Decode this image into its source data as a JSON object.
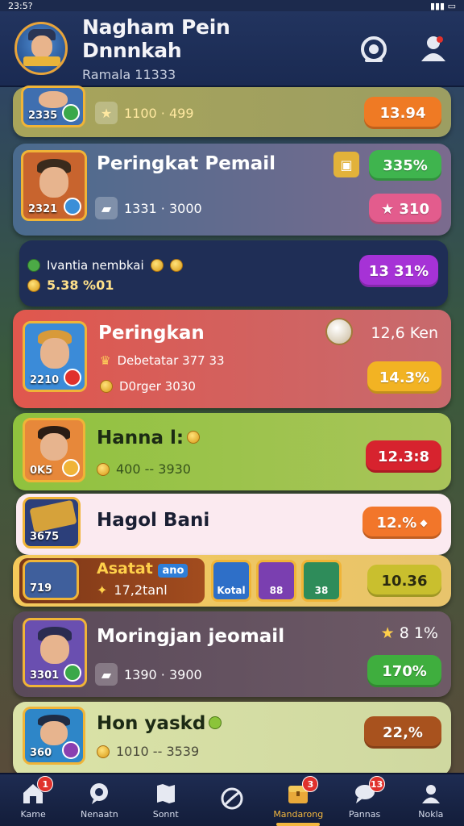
{
  "status": {
    "time": "23:5?"
  },
  "header": {
    "title": "Nagham Pein Dnnnkah",
    "subtitle": "Ramala 11333"
  },
  "cards": [
    {
      "stat": "1100 · 499",
      "pill": "13.94"
    },
    {
      "title": "Peringkat Pemail",
      "avatar_num": "2321",
      "stat": "1331 · 3000",
      "pill_top": "335%",
      "pill": "310"
    },
    {
      "text": "Ivantia nembkai",
      "amount": "5.38 %01",
      "pill": "13 31%"
    },
    {
      "title": "Peringkan",
      "avatar_num": "2210",
      "stat1": "Debetatar 377 33",
      "stat2": "D0rger 3030",
      "right_text": "12,6 Ken",
      "pill": "14.3%"
    },
    {
      "title": "Hanna l:",
      "avatar_num": "0K5",
      "stat": "400 -- 3930",
      "pill": "12.3:8"
    },
    {
      "title": "Hagol Bani",
      "avatar_num": "3675",
      "pill": "12.%"
    },
    {
      "title": "Asatat",
      "title_tag": "ano",
      "avatar_num": "719",
      "stat": "17,2tanl",
      "tiles": [
        "Kotal",
        "88",
        "38"
      ],
      "pill": "10.36"
    },
    {
      "title": "Moringjan jeomail",
      "avatar_num": "3301",
      "stat": "1390 · 3900",
      "right_text": "8 1%",
      "pill": "170%"
    },
    {
      "title": "Hon yaskd",
      "avatar_num": "360",
      "stat": "1010 -- 3539",
      "pill": "22,%"
    }
  ],
  "nav": [
    {
      "label": "Kame",
      "badge": "1"
    },
    {
      "label": "Nenaatn",
      "badge": ""
    },
    {
      "label": "Sonnt",
      "badge": ""
    },
    {
      "label": "",
      "badge": ""
    },
    {
      "label": "Mandarong",
      "badge": "3"
    },
    {
      "label": "Pannas",
      "badge": "13"
    },
    {
      "label": "Nokla",
      "badge": ""
    }
  ]
}
